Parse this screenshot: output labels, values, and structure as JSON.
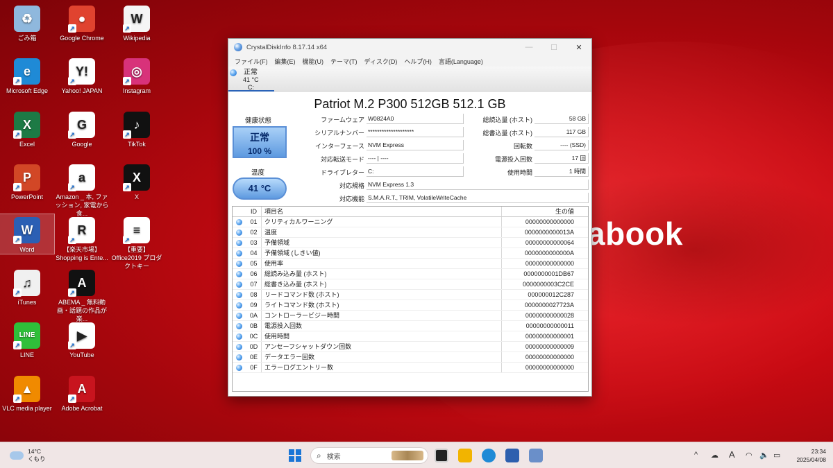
{
  "wallpaper": {
    "text": "abook"
  },
  "desktop_icons": [
    {
      "label": "ごみ箱",
      "icon": "recycle-bin-icon",
      "color": "#8fb8dd",
      "glyph": "♻"
    },
    {
      "label": "Google Chrome",
      "icon": "chrome-icon",
      "color": "#e0432f",
      "glyph": "●"
    },
    {
      "label": "Wikipedia",
      "icon": "wikipedia-icon",
      "color": "#f5f5f5",
      "glyph": "W"
    },
    {
      "label": "Microsoft Edge",
      "icon": "edge-icon",
      "color": "#1f8ad6",
      "glyph": "e"
    },
    {
      "label": "Yahoo! JAPAN",
      "icon": "yahoo-icon",
      "color": "#ffffff",
      "glyph": "Y!"
    },
    {
      "label": "Instagram",
      "icon": "instagram-icon",
      "color": "#d8327a",
      "glyph": "◎"
    },
    {
      "label": "Excel",
      "icon": "excel-icon",
      "color": "#1d7a45",
      "glyph": "X"
    },
    {
      "label": "Google",
      "icon": "google-icon",
      "color": "#ffffff",
      "glyph": "G"
    },
    {
      "label": "TikTok",
      "icon": "tiktok-icon",
      "color": "#111111",
      "glyph": "♪"
    },
    {
      "label": "PowerPoint",
      "icon": "powerpoint-icon",
      "color": "#d24726",
      "glyph": "P"
    },
    {
      "label": "Amazon _ 本, ファッション, 家電から食...",
      "icon": "amazon-icon",
      "color": "#ffffff",
      "glyph": "a"
    },
    {
      "label": "X",
      "icon": "x-icon",
      "color": "#111111",
      "glyph": "X"
    },
    {
      "label": "Word",
      "icon": "word-icon",
      "color": "#2b5fb4",
      "glyph": "W"
    },
    {
      "label": "【楽天市場】Shopping is Ente...",
      "icon": "rakuten-icon",
      "color": "#ffffff",
      "glyph": "R"
    },
    {
      "label": "【重要】Office2019 プロダクトキー",
      "icon": "document-icon",
      "color": "#ffffff",
      "glyph": "≡"
    },
    {
      "label": "iTunes",
      "icon": "itunes-icon",
      "color": "#f0f0f0",
      "glyph": "♫"
    },
    {
      "label": "ABEMA _ 無料動画・話題の作品が楽...",
      "icon": "abema-icon",
      "color": "#111111",
      "glyph": "A"
    },
    {
      "label": "LINE",
      "icon": "line-icon",
      "color": "#2fbf3a",
      "glyph": "LINE"
    },
    {
      "label": "YouTube",
      "icon": "youtube-icon",
      "color": "#ffffff",
      "glyph": "▶"
    },
    {
      "label": "VLC media player",
      "icon": "vlc-icon",
      "color": "#f08a00",
      "glyph": "▲"
    },
    {
      "label": "Adobe Acrobat",
      "icon": "acrobat-icon",
      "color": "#c8141e",
      "glyph": "A"
    }
  ],
  "window": {
    "title": "CrystalDiskInfo 8.17.14 x64",
    "controls": {
      "minimize": "—",
      "maximize": "☐",
      "close": "✕"
    },
    "menu": [
      "ファイル(F)",
      "編集(E)",
      "機能(U)",
      "テーマ(T)",
      "ディスク(D)",
      "ヘルプ(H)",
      "言語(Language)"
    ],
    "drive_tab": {
      "status": "正常",
      "temp": "41 °C",
      "letter": "C:"
    },
    "model": "Patriot M.2 P300 512GB 512.1 GB",
    "health": {
      "label": "健康状態",
      "status": "正常",
      "percent": "100 %"
    },
    "temperature": {
      "label": "温度",
      "value": "41 °C"
    },
    "props_left": [
      {
        "label": "ファームウェア",
        "value": "W0824A0"
      },
      {
        "label": "シリアルナンバー",
        "value": "********************"
      },
      {
        "label": "インターフェース",
        "value": "NVM Express"
      },
      {
        "label": "対応転送モード",
        "value": "---- | ----"
      },
      {
        "label": "ドライブレター",
        "value": "C:"
      }
    ],
    "props_right": [
      {
        "label": "総読込量 (ホスト)",
        "value": "58 GB"
      },
      {
        "label": "総書込量 (ホスト)",
        "value": "117 GB"
      },
      {
        "label": "回転数",
        "value": "---- (SSD)"
      },
      {
        "label": "電源投入回数",
        "value": "17 回"
      },
      {
        "label": "使用時間",
        "value": "1 時間"
      }
    ],
    "props_wide": [
      {
        "label": "対応規格",
        "value": "NVM Express 1.3"
      },
      {
        "label": "対応機能",
        "value": "S.M.A.R.T., TRIM, VolatileWriteCache"
      }
    ],
    "smart": {
      "headers": {
        "id": "ID",
        "name": "項目名",
        "raw": "生の値"
      },
      "rows": [
        {
          "id": "01",
          "name": "クリティカルワーニング",
          "raw": "00000000000000"
        },
        {
          "id": "02",
          "name": "温度",
          "raw": "0000000000013A"
        },
        {
          "id": "03",
          "name": "予備領域",
          "raw": "00000000000064"
        },
        {
          "id": "04",
          "name": "予備領域 (しきい値)",
          "raw": "0000000000000A"
        },
        {
          "id": "05",
          "name": "使用率",
          "raw": "00000000000000"
        },
        {
          "id": "06",
          "name": "総読み込み量 (ホスト)",
          "raw": "0000000001DB67"
        },
        {
          "id": "07",
          "name": "総書き込み量 (ホスト)",
          "raw": "0000000003C2CE"
        },
        {
          "id": "08",
          "name": "リードコマンド数 (ホスト)",
          "raw": "000000012C287"
        },
        {
          "id": "09",
          "name": "ライトコマンド数 (ホスト)",
          "raw": "0000000027723A"
        },
        {
          "id": "0A",
          "name": "コントローラービジー時間",
          "raw": "00000000000028"
        },
        {
          "id": "0B",
          "name": "電源投入回数",
          "raw": "00000000000011"
        },
        {
          "id": "0C",
          "name": "使用時間",
          "raw": "00000000000001"
        },
        {
          "id": "0D",
          "name": "アンセーフシャットダウン回数",
          "raw": "00000000000009"
        },
        {
          "id": "0E",
          "name": "データエラー回数",
          "raw": "00000000000000"
        },
        {
          "id": "0F",
          "name": "エラーログエントリー数",
          "raw": "00000000000000"
        }
      ]
    }
  },
  "taskbar": {
    "weather_temp": "14°C",
    "weather_desc": "くもり",
    "search_placeholder": "検索",
    "input_indicator": "A",
    "time": "23:34",
    "date": "2025/04/08"
  }
}
